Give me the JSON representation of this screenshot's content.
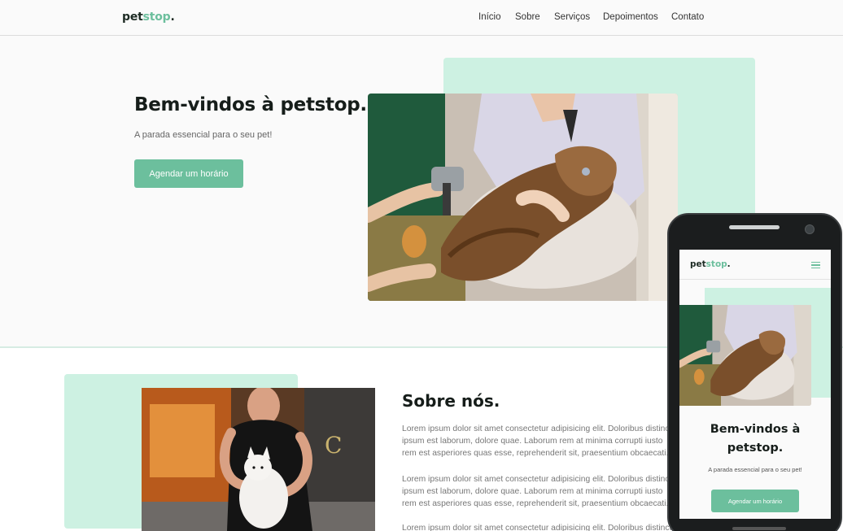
{
  "brand": {
    "part1": "pet",
    "part2": "stop",
    "part3": ".",
    "accent": "#6cbf9d",
    "mint": "#cdf1e2"
  },
  "nav": {
    "items": [
      "Início",
      "Sobre",
      "Serviços",
      "Depoimentos",
      "Contato"
    ]
  },
  "hero": {
    "title": "Bem-vindos à petstop.",
    "subtitle": "A parada essencial para o seu pet!",
    "cta": "Agendar um horário"
  },
  "about": {
    "title": "Sobre nós.",
    "paragraphs": [
      "Lorem ipsum dolor sit amet consectetur adipisicing elit. Doloribus distinctio ipsum est laborum, dolore quae. Laborum rem at minima corrupti iusto rem est asperiores quas esse, reprehenderit sit, praesentium obcaecati.",
      "Lorem ipsum dolor sit amet consectetur adipisicing elit. Doloribus distinctio ipsum est laborum, dolore quae. Laborum rem at minima corrupti iusto rem est asperiores quas esse, reprehenderit sit, praesentium obcaecati.",
      "Lorem ipsum dolor sit amet consectetur adipisicing elit. Doloribus distinctio"
    ]
  },
  "mobile": {
    "title_line1": "Bem-vindos à",
    "title_line2": "petstop.",
    "subtitle": "A parada essencial para o seu pet!",
    "cta": "Agendar um horário",
    "menu_icon": "hamburger-menu-icon"
  }
}
